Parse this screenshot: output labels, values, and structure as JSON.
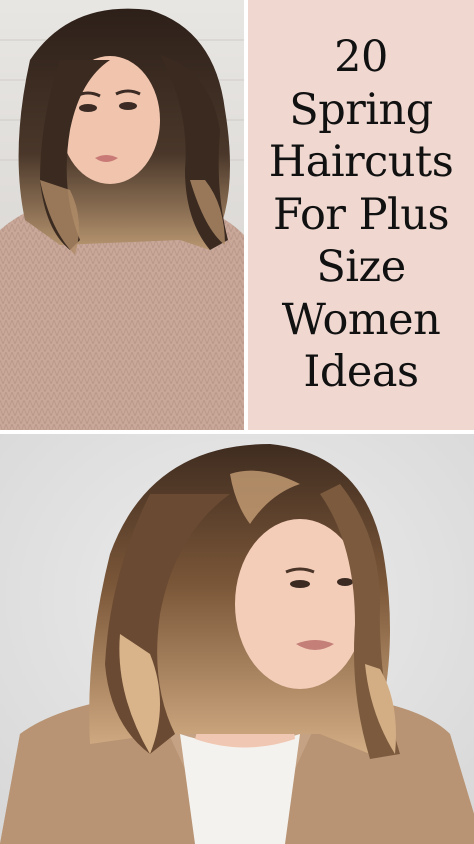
{
  "title": {
    "lines": [
      "20",
      "Spring",
      "Haircuts",
      "For Plus",
      "Size",
      "Women",
      "Ideas"
    ]
  },
  "colors": {
    "title_panel_bg": "#f0d8d1",
    "title_text": "#111111",
    "sweater": "#c9a89a",
    "coat": "#c4a283",
    "hair_dark": "#3a2a20",
    "hair_highlight": "#c9a07a"
  }
}
